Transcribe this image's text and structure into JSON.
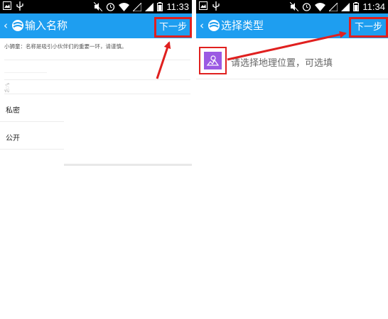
{
  "left_screen": {
    "status_time": "11:33",
    "title": "输入名称",
    "next_button": "下一步",
    "hint": "小狮童：名称是吸引小伙伴们的重要一环，请谨慎。",
    "small_mark": "ᬼ",
    "options": [
      "私密",
      "公开"
    ]
  },
  "right_screen": {
    "status_time": "11:34",
    "title": "选择类型",
    "next_button": "下一步",
    "location_prompt": "请选择地理位置，可选填"
  },
  "colors": {
    "app_bar": "#1e9ef0",
    "highlight_red": "#e0201f",
    "location_icon_purple": "#9b5ae3",
    "status_bar": "#000000"
  },
  "icons": {
    "back": "chevron-left-icon",
    "app_logo": "globe-logo-icon",
    "location": "map-location-icon"
  }
}
